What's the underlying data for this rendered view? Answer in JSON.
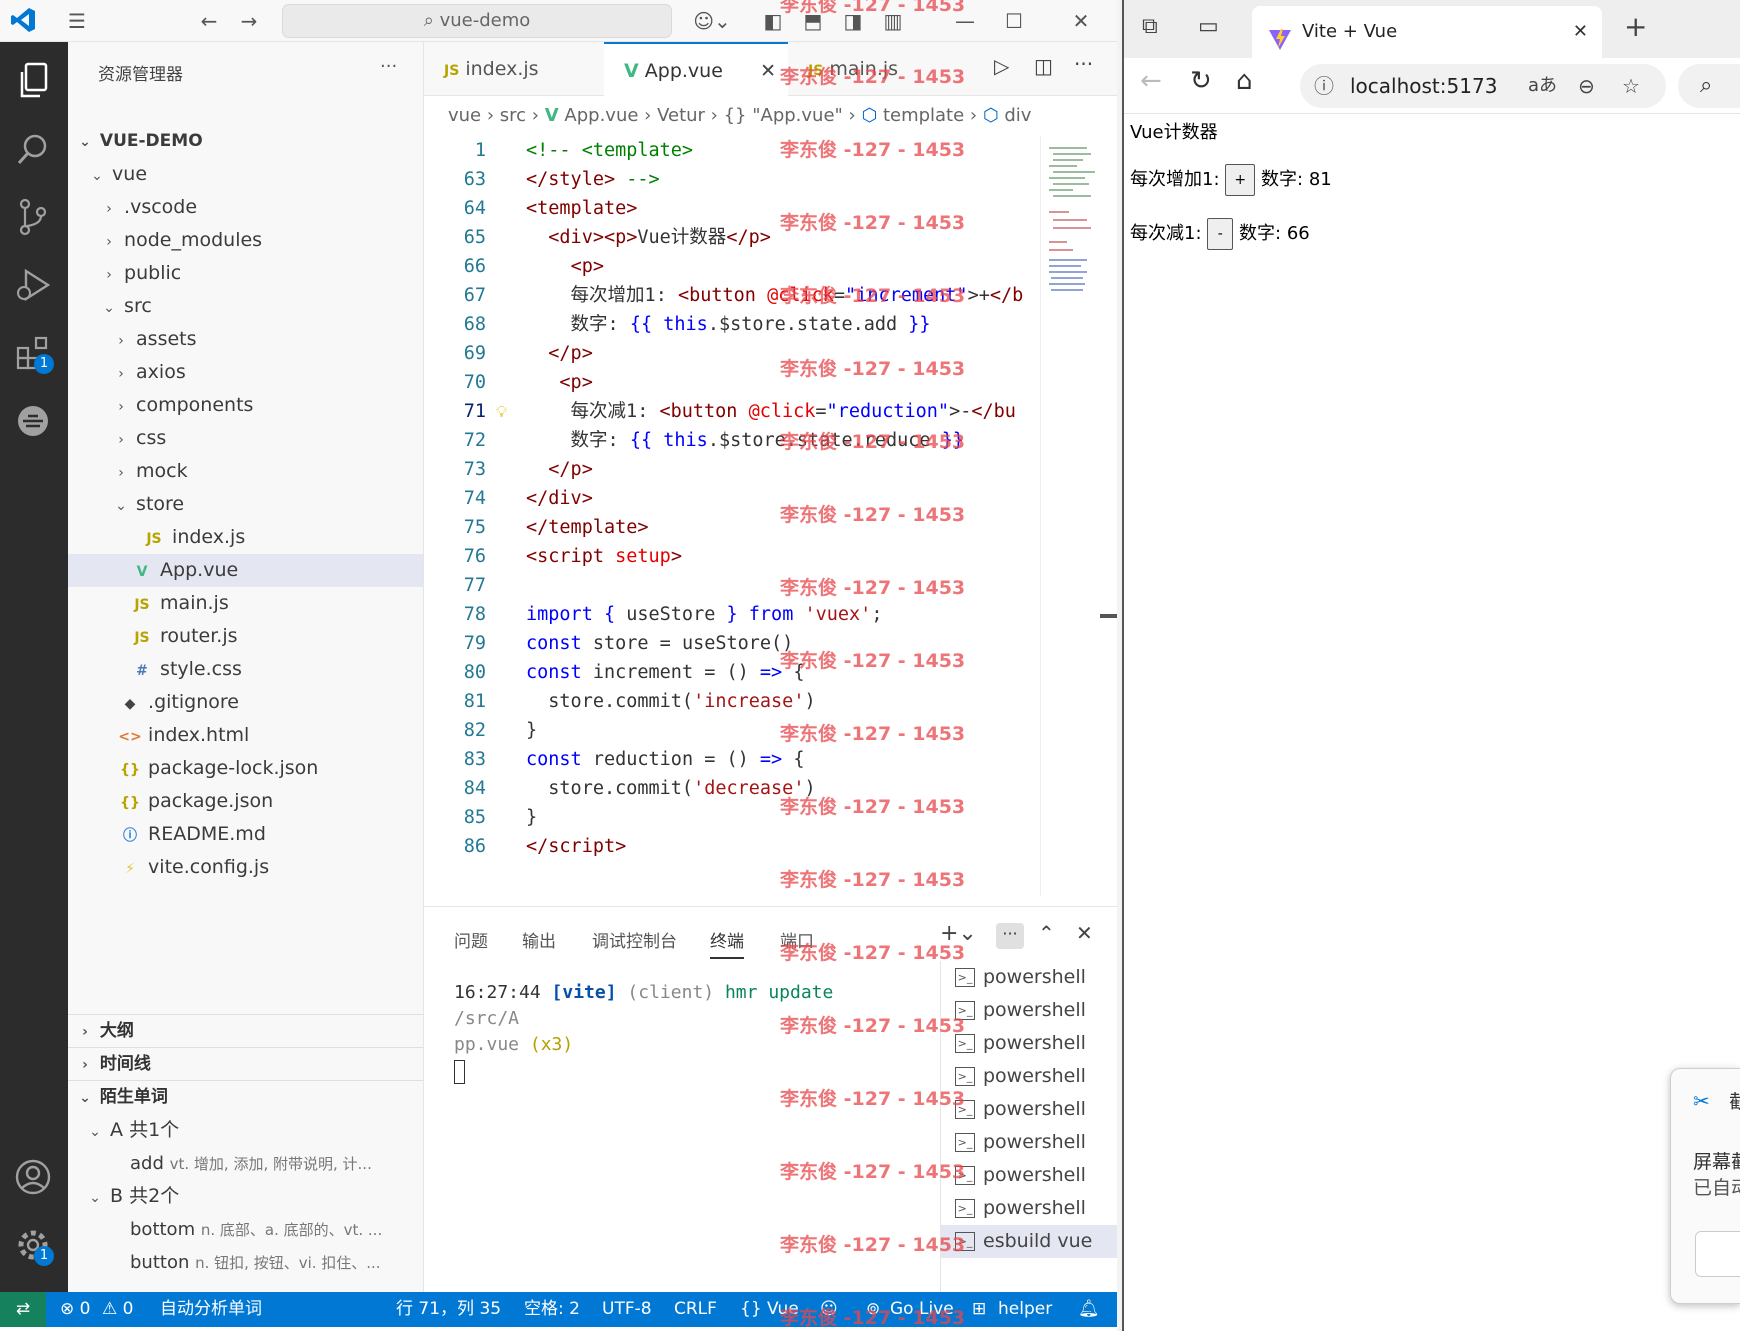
{
  "vscode": {
    "search_placeholder": "vue-demo",
    "sidebar": {
      "title": "资源管理器",
      "more": "···",
      "root": "VUE-DEMO",
      "tree": [
        {
          "label": "vue",
          "indent": 1,
          "chev": "⌄",
          "icon": ""
        },
        {
          "label": ".vscode",
          "indent": 2,
          "chev": "›",
          "icon": ""
        },
        {
          "label": "node_modules",
          "indent": 2,
          "chev": "›",
          "icon": ""
        },
        {
          "label": "public",
          "indent": 2,
          "chev": "›",
          "icon": ""
        },
        {
          "label": "src",
          "indent": 2,
          "chev": "⌄",
          "icon": ""
        },
        {
          "label": "assets",
          "indent": 3,
          "chev": "›",
          "icon": ""
        },
        {
          "label": "axios",
          "indent": 3,
          "chev": "›",
          "icon": ""
        },
        {
          "label": "components",
          "indent": 3,
          "chev": "›",
          "icon": ""
        },
        {
          "label": "css",
          "indent": 3,
          "chev": "›",
          "icon": ""
        },
        {
          "label": "mock",
          "indent": 3,
          "chev": "›",
          "icon": ""
        },
        {
          "label": "store",
          "indent": 3,
          "chev": "⌄",
          "icon": ""
        },
        {
          "label": "index.js",
          "indent": 4,
          "chev": "",
          "icon": "JS"
        },
        {
          "label": "App.vue",
          "indent": 3,
          "chev": "",
          "icon": "V"
        },
        {
          "label": "main.js",
          "indent": 3,
          "chev": "",
          "icon": "JS"
        },
        {
          "label": "router.js",
          "indent": 3,
          "chev": "",
          "icon": "JS"
        },
        {
          "label": "style.css",
          "indent": 3,
          "chev": "",
          "icon": "#"
        },
        {
          "label": ".gitignore",
          "indent": 2,
          "chev": "",
          "icon": "◆"
        },
        {
          "label": "index.html",
          "indent": 2,
          "chev": "",
          "icon": "<>"
        },
        {
          "label": "package-lock.json",
          "indent": 2,
          "chev": "",
          "icon": "{}"
        },
        {
          "label": "package.json",
          "indent": 2,
          "chev": "",
          "icon": "{}"
        },
        {
          "label": "README.md",
          "indent": 2,
          "chev": "",
          "icon": "ⓘ"
        },
        {
          "label": "vite.config.js",
          "indent": 2,
          "chev": "",
          "icon": "⚡"
        }
      ],
      "sections": {
        "outline": "大纲",
        "timeline": "时间线",
        "words": "陌生单词"
      },
      "words": {
        "group_a": "A  共1个",
        "word_add": "add",
        "word_add_def": "vt. 增加, 添加, 附带说明, 计...",
        "group_b": "B  共2个",
        "word_bottom": "bottom",
        "word_bottom_def": "n. 底部、a. 底部的、vt. ...",
        "word_button": "button",
        "word_button_def": "n. 钮扣, 按钮、vi. 扣住、..."
      }
    },
    "tabs": [
      {
        "label": "index.js",
        "icon": "JS",
        "active": false
      },
      {
        "label": "App.vue",
        "icon": "V",
        "active": true
      },
      {
        "label": "main.js",
        "icon": "JS",
        "active": false
      }
    ],
    "breadcrumb": [
      "vue",
      "src",
      "App.vue",
      "Vetur",
      "{} \"App.vue\"",
      "template",
      "div"
    ],
    "code": [
      {
        "n": "1",
        "html": "<span class='k-cm'>&lt;!-- &lt;template&gt;</span>"
      },
      {
        "n": "63",
        "html": "<span class='k-tag'>&lt;/style&gt;</span> <span class='k-cm'>--&gt;</span>"
      },
      {
        "n": "64",
        "html": "<span class='k-tag'>&lt;template&gt;</span>"
      },
      {
        "n": "65",
        "html": "  <span class='k-tag'>&lt;div&gt;&lt;p&gt;</span>Vue计数器<span class='k-tag'>&lt;/p&gt;</span>"
      },
      {
        "n": "66",
        "html": "    <span class='k-tag'>&lt;p&gt;</span>"
      },
      {
        "n": "67",
        "html": "    每次增加1: <span class='k-tag'>&lt;button</span> <span class='k-attr'>@click</span>=<span class='k-str'>\"increment\"</span>&gt;+<span class='k-tag'>&lt;/b</span>"
      },
      {
        "n": "68",
        "html": "    数字: <span class='k-kw'>{{</span> <span class='k-this'>this</span>.$store.state.add <span class='k-kw'>}}</span>"
      },
      {
        "n": "69",
        "html": "  <span class='k-tag'>&lt;/p&gt;</span>"
      },
      {
        "n": "70",
        "html": "   <span class='k-tag'>&lt;p&gt;</span>"
      },
      {
        "n": "71",
        "html": "    每次减1: <span class='k-tag'>&lt;button</span> <span class='k-attr'>@click</span>=<span class='k-str'>\"reduction\"</span>&gt;-<span class='k-tag'>&lt;/bu</span>"
      },
      {
        "n": "72",
        "html": "    数字: <span class='k-kw'>{{</span> <span class='k-this'>this</span>.$store.state.reduce <span class='k-kw'>}}</span>"
      },
      {
        "n": "73",
        "html": "  <span class='k-tag'>&lt;/p&gt;</span>"
      },
      {
        "n": "74",
        "html": "<span class='k-tag'>&lt;/div&gt;</span>"
      },
      {
        "n": "75",
        "html": "<span class='k-tag'>&lt;/template&gt;</span>"
      },
      {
        "n": "76",
        "html": "<span class='k-tag'>&lt;script</span> <span class='k-attr'>setup</span><span class='k-tag'>&gt;</span>"
      },
      {
        "n": "77",
        "html": ""
      },
      {
        "n": "78",
        "html": "<span class='k-kw'>import</span> <span class='k-kw'>{</span> useStore <span class='k-kw'>}</span> <span class='k-kw'>from</span> <span class='k-s2'>'vuex'</span>;"
      },
      {
        "n": "79",
        "html": "<span class='k-kw'>const</span> store = useStore()"
      },
      {
        "n": "80",
        "html": "<span class='k-kw'>const</span> increment = () <span class='k-kw'>=&gt;</span> {"
      },
      {
        "n": "81",
        "html": "  store.commit(<span class='k-s2'>'increase'</span>)"
      },
      {
        "n": "82",
        "html": "}"
      },
      {
        "n": "83",
        "html": "<span class='k-kw'>const</span> reduction = () <span class='k-kw'>=&gt;</span> {"
      },
      {
        "n": "84",
        "html": "  store.commit(<span class='k-s2'>'decrease'</span>)"
      },
      {
        "n": "85",
        "html": "}"
      },
      {
        "n": "86",
        "html": "<span class='k-tag'>&lt;/script&gt;</span>"
      }
    ],
    "panel": {
      "tabs": [
        "问题",
        "输出",
        "调试控制台",
        "终端",
        "端口"
      ],
      "terminal_time": "16:27:44",
      "terminal_tag": "[vite]",
      "terminal_client": "(client)",
      "terminal_msg": "hmr update",
      "terminal_path_1": "/src/A",
      "terminal_path_2": "pp.vue",
      "terminal_count": "(x3)",
      "terminals": [
        "powershell",
        "powershell",
        "powershell",
        "powershell",
        "powershell",
        "powershell",
        "powershell",
        "powershell",
        "esbuild  vue"
      ]
    },
    "statusbar": {
      "errors": "⊗ 0",
      "warnings": "⚠ 0",
      "task": "自动分析单词",
      "position": "行 71，列 35",
      "spaces": "空格: 2",
      "encoding": "UTF-8",
      "eol": "CRLF",
      "language": "{} Vue",
      "golive": "Go Live",
      "helper": "helper"
    }
  },
  "browser": {
    "tab_title": "Vite + Vue",
    "url": "localhost:5173",
    "read_aloud": "aあ",
    "page": {
      "heading": "Vue计数器",
      "inc_label": "每次增加1:",
      "inc_button": "+",
      "inc_value_label": "数字:",
      "inc_value": "81",
      "dec_label": "每次减1:",
      "dec_button": "-",
      "dec_value_label": "数字:",
      "dec_value": "66"
    },
    "snip_title": "截",
    "snip_line1": "屏幕截",
    "snip_line2": "已自动"
  },
  "watermark": "李东俊 -127 - 1453"
}
